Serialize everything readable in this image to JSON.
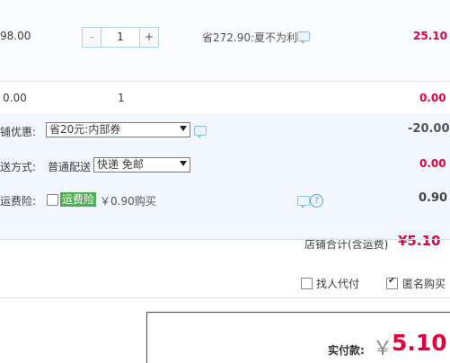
{
  "item": {
    "unit_price": "98.00",
    "qty_minus": "-",
    "quantity": "1",
    "qty_plus": "+",
    "savings_text": "省272.90:夏不为利",
    "subtotal": "25.10"
  },
  "summary_row": {
    "price": "0.00",
    "count": "1",
    "total": "0.00"
  },
  "shop_discount": {
    "label": "铺优惠:",
    "selected": "省20元:内部券",
    "amount": "-20.00"
  },
  "shipping": {
    "label": "送方式:",
    "method_text": "普通配送",
    "selected": "快递 免邮",
    "amount": "0.00"
  },
  "insurance": {
    "label": "运费险:",
    "tag": "运费险",
    "price_text": "￥0.90购买",
    "help": "?",
    "amount": "0.90"
  },
  "shop_total": {
    "label": "店铺合计(含运费)",
    "amount": "¥5.10"
  },
  "options": {
    "proxy_pay": "找人代付",
    "anonymous": "匿名购买"
  },
  "payment": {
    "label": "实付款:",
    "currency": "￥",
    "amount": "5.10"
  },
  "colors": {
    "accent_red": "#e4003b",
    "panel_blue": "#f2f7ff",
    "border_blue": "#cfe0ef",
    "tag_green": "#4caf50"
  }
}
